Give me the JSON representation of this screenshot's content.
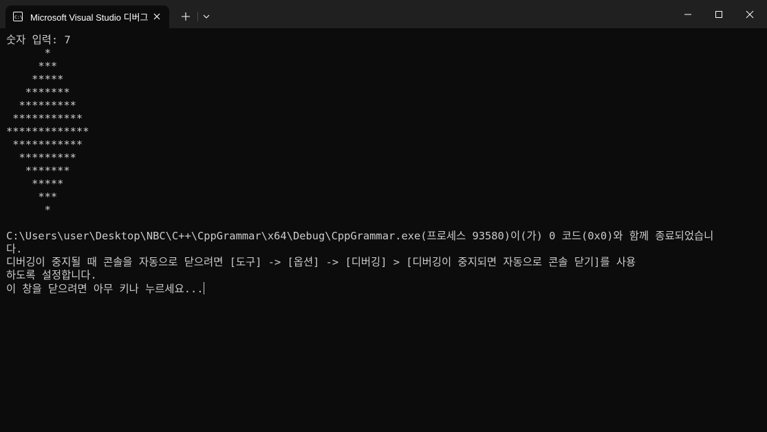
{
  "window": {
    "tab_title": "Microsoft Visual Studio 디버그 콘솔",
    "tab_title_visible": "Microsoft Visual Studio 디버그",
    "tab_icon": "terminal-icon",
    "close_tab_icon": "close-icon",
    "new_tab_icon": "plus-icon",
    "dropdown_icon": "chevron-down-icon",
    "controls": [
      "minimize-icon",
      "maximize-icon",
      "close-icon"
    ]
  },
  "colors": {
    "titlebar_bg": "#202020",
    "console_bg": "#0c0c0c",
    "console_text": "#cccccc"
  },
  "console": {
    "lines": [
      "숫자 입력: 7",
      "      *",
      "     ***",
      "    *****",
      "   *******",
      "  *********",
      " ***********",
      "*************",
      " ***********",
      "  *********",
      "   *******",
      "    *****",
      "     ***",
      "      *",
      "",
      "C:\\Users\\user\\Desktop\\NBC\\C++\\CppGrammar\\x64\\Debug\\CppGrammar.exe(프로세스 93580)이(가) 0 코드(0x0)와 함께 종료되었습니",
      "다.",
      "디버깅이 중지될 때 콘솔을 자동으로 닫으려면 [도구] -> [옵션] -> [디버깅] > [디버깅이 중지되면 자동으로 콘솔 닫기]를 사용",
      "하도록 설정합니다."
    ],
    "prompt_line": "이 창을 닫으려면 아무 키나 누르세요..."
  }
}
